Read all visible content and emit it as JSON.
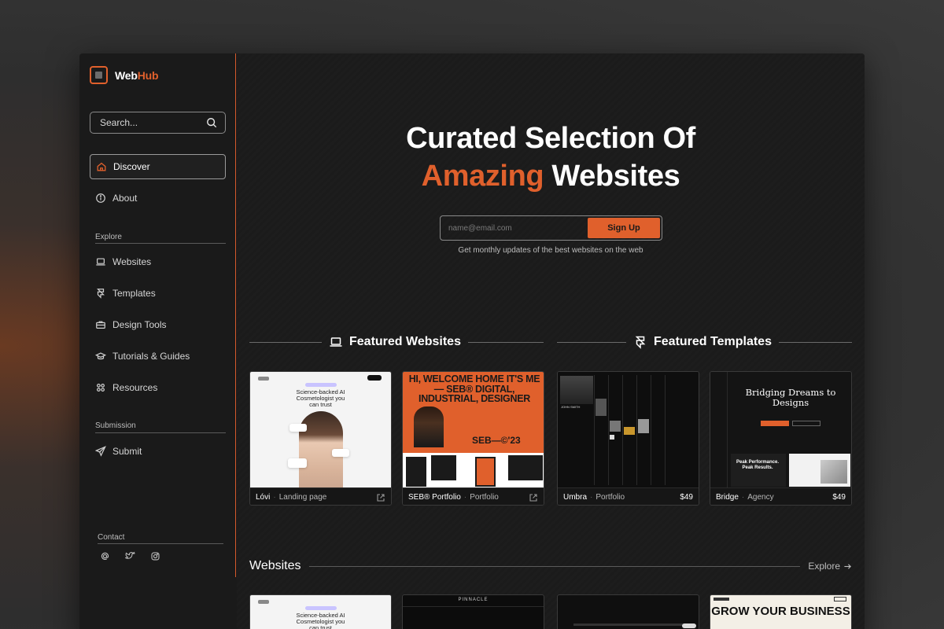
{
  "brand": {
    "web": "Web",
    "hub": "Hub"
  },
  "search": {
    "placeholder": "Search..."
  },
  "nav": {
    "discover": "Discover",
    "about": "About",
    "explore_label": "Explore",
    "websites": "Websites",
    "templates": "Templates",
    "design_tools": "Design Tools",
    "tutorials": "Tutorials & Guides",
    "resources": "Resources",
    "submission_label": "Submission",
    "submit": "Submit",
    "contact_label": "Contact"
  },
  "hero": {
    "line1": "Curated Selection Of",
    "accent": "Amazing",
    "rest": " Websites",
    "email_placeholder": "name@email.com",
    "signup_button": "Sign Up",
    "note": "Get monthly updates of the best websites on the web"
  },
  "featured_websites_title": "Featured Websites",
  "featured_templates_title": "Featured Templates",
  "cards": [
    {
      "name": "Lóvi",
      "category": "Landing page",
      "headline": "Science-backed AI Cosmetologist you can trust"
    },
    {
      "name": "SEB® Portfolio",
      "category": "Portfolio",
      "headline": "HI, WELCOME HOME IT'S ME — SEB® DIGITAL, INDUSTRIAL, DESIGNER",
      "footer": "SEB—©'23"
    },
    {
      "name": "Umbra",
      "category": "Portfolio",
      "price": "$49",
      "label": "JOHN SMITH"
    },
    {
      "name": "Bridge",
      "category": "Agency",
      "price": "$49",
      "headline": "Bridging Dreams to Designs",
      "sub": "Peak Performance. Peak Results."
    }
  ],
  "websites_section": {
    "title": "Websites",
    "explore": "Explore"
  },
  "bottom_cards": [
    {
      "headline": "Science-backed AI Cosmetologist you can trust"
    },
    {
      "headline": "PINNACLE"
    },
    {
      "headline": ""
    },
    {
      "headline": "GROW YOUR BUSINESS"
    }
  ],
  "colors": {
    "accent": "#e0602c",
    "bg": "#1a1a1a"
  }
}
